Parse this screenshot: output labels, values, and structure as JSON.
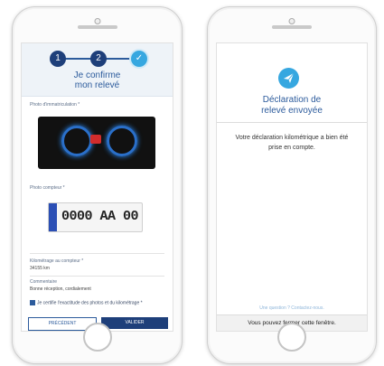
{
  "left_screen": {
    "steps": [
      "1",
      "2",
      "✓"
    ],
    "title_line1": "Je confirme",
    "title_line2": "mon relevé",
    "photo_dashboard_label": "Photo d'immatriculation *",
    "photo_meter_label": "Photo compteur *",
    "plate_text": "0000 AA 00",
    "mileage_label": "Kilométrage au compteur *",
    "mileage_value": "34155 km",
    "comment_label": "Commentaire",
    "comment_value": "Bonne réception, cordialement",
    "certify_text": "Je certifie l'exactitude des photos et du kilométrage *",
    "btn_previous": "PRÉCÉDENT",
    "btn_validate": "VALIDER"
  },
  "right_screen": {
    "title_line1": "Déclaration de",
    "title_line2": "relevé envoyée",
    "message_line1": "Votre déclaration kilométrique a bien été",
    "message_line2": "prise en compte.",
    "link_text": "Une question ? Contactez-nous.",
    "footer_text": "Vous pouvez fermer cette fenêtre."
  },
  "colors": {
    "primary": "#1e3f7a",
    "accent": "#36a7e0"
  },
  "icons": {
    "send": "paper-plane-icon",
    "check": "checkmark-icon"
  }
}
